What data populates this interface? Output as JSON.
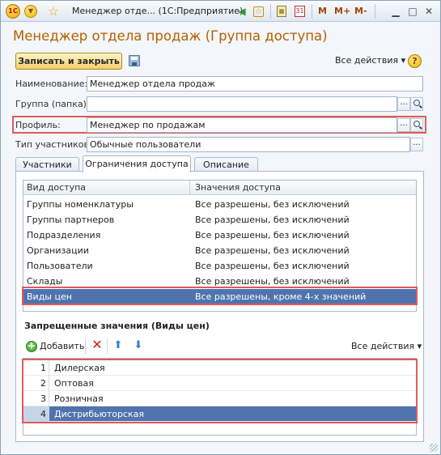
{
  "window": {
    "title": "Менеджер отде...  (1С:Предприятие)",
    "toolbar_m": [
      "M",
      "M+",
      "M-"
    ]
  },
  "form": {
    "title": "Менеджер отдела продаж (Группа доступа)",
    "save_close_label": "Записать и закрыть",
    "all_actions_label": "Все действия",
    "help_label": "?"
  },
  "fields": {
    "name": {
      "label": "Наименование:",
      "value": "Менеджер отдела продаж"
    },
    "group": {
      "label": "Группа (папка):",
      "value": ""
    },
    "profile": {
      "label": "Профиль:",
      "value": "Менеджер по продажам"
    },
    "members_type": {
      "label": "Тип участников:",
      "value": "Обычные пользователи"
    }
  },
  "tabs": [
    {
      "label": "Участники"
    },
    {
      "label": "Ограничения доступа"
    },
    {
      "label": "Описание"
    }
  ],
  "access_table": {
    "columns": [
      "Вид доступа",
      "Значения доступа"
    ],
    "rows": [
      [
        "Группы номенклатуры",
        "Все разрешены, без исключений"
      ],
      [
        "Группы партнеров",
        "Все разрешены, без исключений"
      ],
      [
        "Подразделения",
        "Все разрешены, без исключений"
      ],
      [
        "Организации",
        "Все разрешены, без исключений"
      ],
      [
        "Пользователи",
        "Все разрешены, без исключений"
      ],
      [
        "Склады",
        "Все разрешены, без исключений"
      ],
      [
        "Виды цен",
        "Все разрешены, кроме 4-х значений"
      ]
    ],
    "selected_index": 6
  },
  "forbidden": {
    "title": "Запрещенные значения (Виды цен)",
    "add_label": "Добавить",
    "all_actions_label": "Все действия",
    "rows": [
      {
        "n": "1",
        "name": "Дилерская"
      },
      {
        "n": "2",
        "name": "Оптовая"
      },
      {
        "n": "3",
        "name": "Розничная"
      },
      {
        "n": "4",
        "name": "Дистрибьюторская"
      }
    ],
    "selected_index": 3
  },
  "colors": {
    "title_accent": "#b36100",
    "highlight_box": "#e05a5a",
    "selection": "#4f74ad"
  },
  "icons": [
    "1c-logo-icon",
    "main-menu-icon",
    "favorite-star-icon",
    "back-arrow-icon",
    "forward-arrow-icon",
    "bookmark-icon",
    "calculator-icon",
    "calendar-icon",
    "minimize-icon",
    "maximize-icon",
    "close-icon",
    "save-icon",
    "help-icon",
    "add-icon",
    "delete-icon",
    "move-up-icon",
    "move-down-icon",
    "select-ellipsis-icon",
    "search-icon"
  ]
}
